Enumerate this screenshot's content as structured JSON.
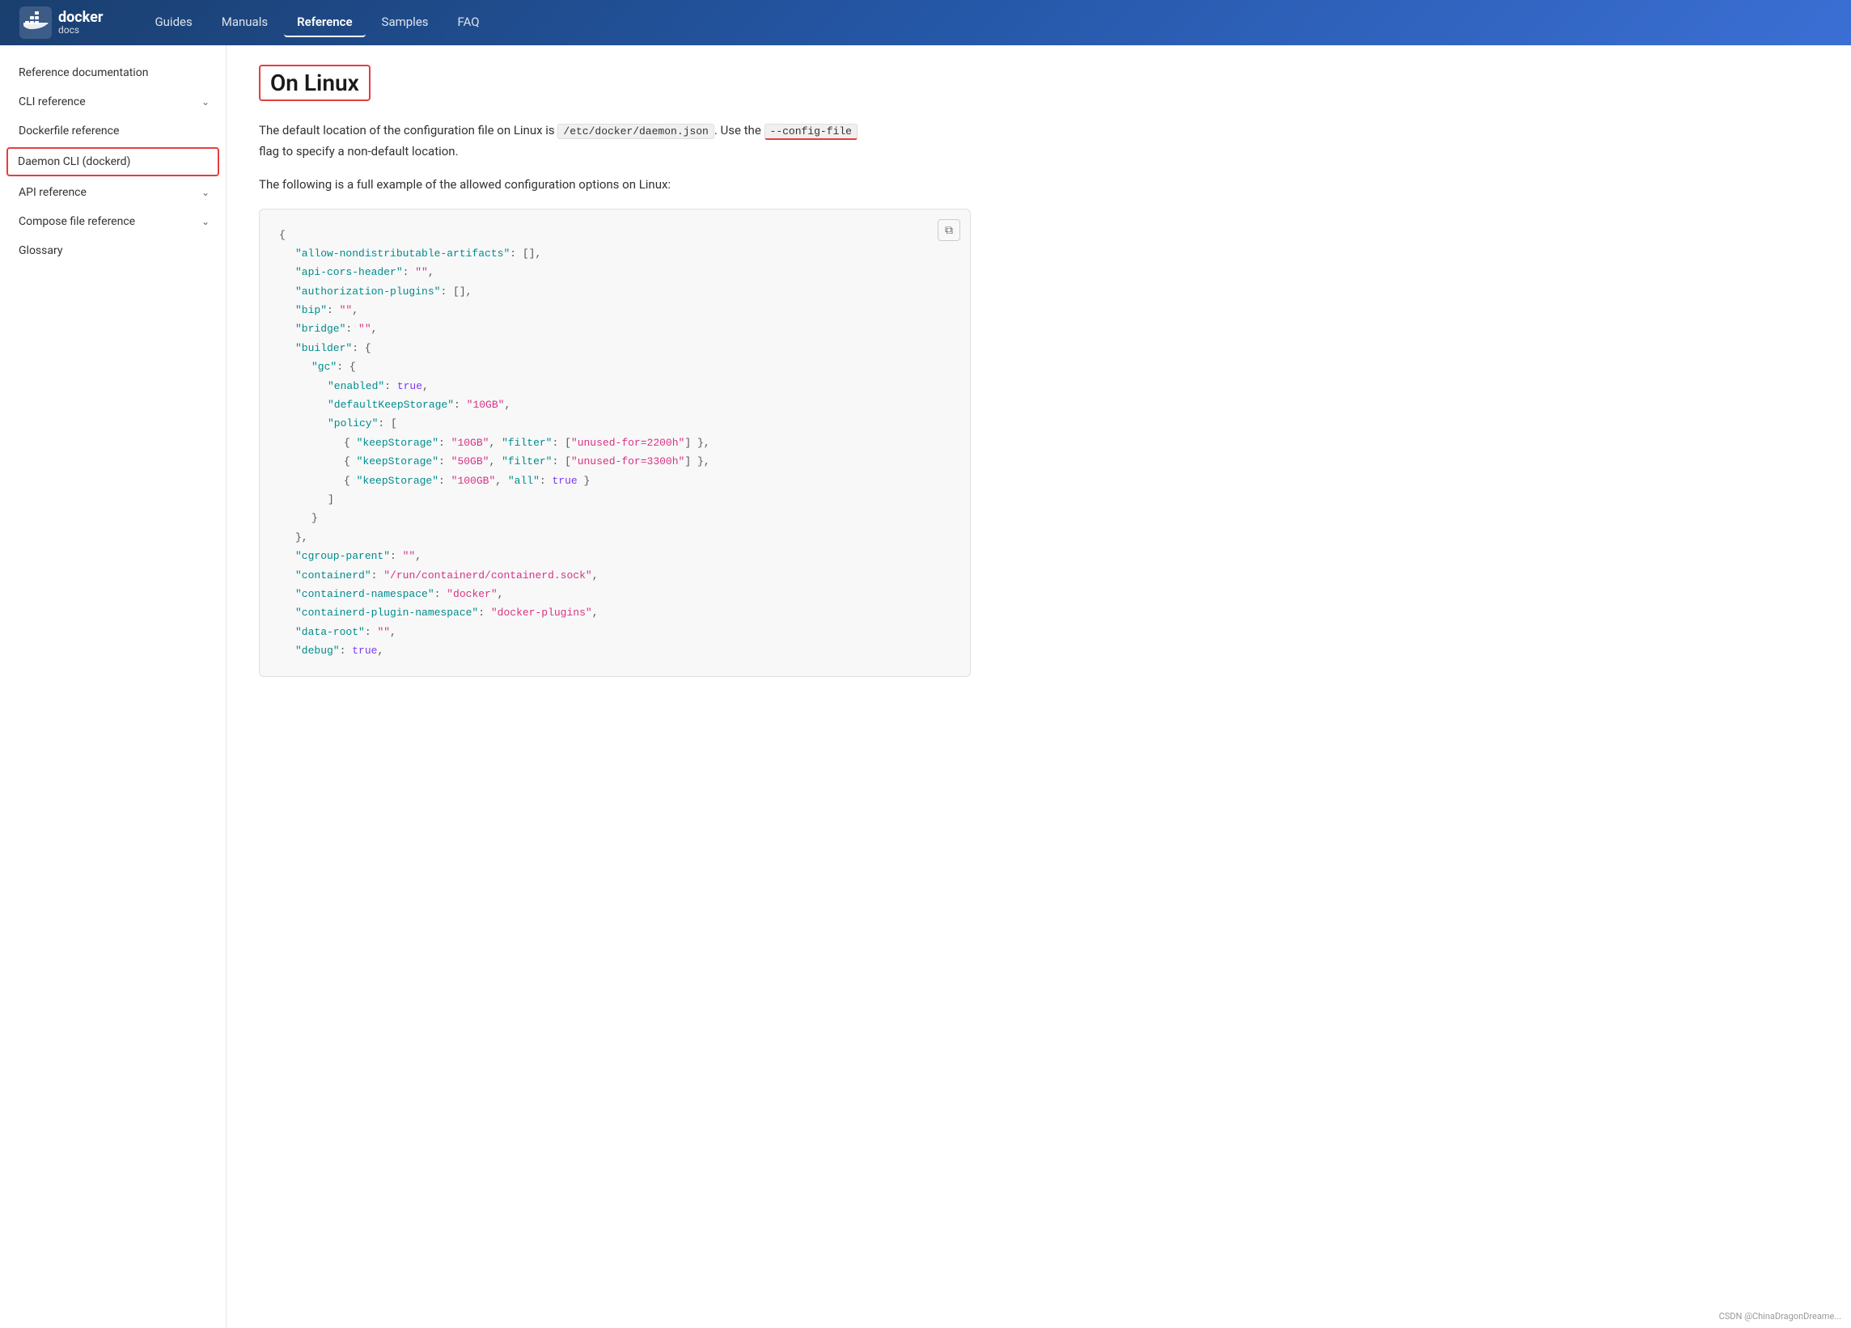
{
  "header": {
    "logo_line1": "docker",
    "logo_line2": "docs",
    "nav_items": [
      {
        "label": "Guides",
        "active": false
      },
      {
        "label": "Manuals",
        "active": false
      },
      {
        "label": "Reference",
        "active": true
      },
      {
        "label": "Samples",
        "active": false
      },
      {
        "label": "FAQ",
        "active": false
      }
    ]
  },
  "sidebar": {
    "items": [
      {
        "label": "Reference documentation",
        "has_chevron": false,
        "active": false
      },
      {
        "label": "CLI reference",
        "has_chevron": true,
        "active": false
      },
      {
        "label": "Dockerfile reference",
        "has_chevron": false,
        "active": false
      },
      {
        "label": "Daemon CLI (dockerd)",
        "has_chevron": false,
        "active": true
      },
      {
        "label": "API reference",
        "has_chevron": true,
        "active": false
      },
      {
        "label": "Compose file reference",
        "has_chevron": true,
        "active": false
      },
      {
        "label": "Glossary",
        "has_chevron": false,
        "active": false
      }
    ]
  },
  "main": {
    "title": "On Linux",
    "description1_pre": "The default location of the configuration file on Linux is ",
    "description1_code1": "/etc/docker/daemon.json",
    "description1_mid": ". Use the ",
    "description1_code2": "--config-file",
    "description1_post": "",
    "description1_line2": "flag to specify a non-default location.",
    "description2": "The following is a full example of the allowed configuration options on Linux:",
    "copy_button_label": "⧉",
    "code_lines": [
      {
        "indent": 0,
        "content": [
          {
            "type": "brace",
            "text": "{"
          }
        ]
      },
      {
        "indent": 1,
        "content": [
          {
            "type": "key",
            "text": "\"allow-nondistributable-artifacts\""
          },
          {
            "type": "punct",
            "text": ": "
          },
          {
            "type": "bracket",
            "text": "[]"
          },
          {
            "type": "punct",
            "text": ","
          }
        ]
      },
      {
        "indent": 1,
        "content": [
          {
            "type": "key",
            "text": "\"api-cors-header\""
          },
          {
            "type": "punct",
            "text": ": "
          },
          {
            "type": "string",
            "text": "\"\""
          },
          {
            "type": "punct",
            "text": ","
          }
        ]
      },
      {
        "indent": 1,
        "content": [
          {
            "type": "key",
            "text": "\"authorization-plugins\""
          },
          {
            "type": "punct",
            "text": ": "
          },
          {
            "type": "bracket",
            "text": "[]"
          },
          {
            "type": "punct",
            "text": ","
          }
        ]
      },
      {
        "indent": 1,
        "content": [
          {
            "type": "key",
            "text": "\"bip\""
          },
          {
            "type": "punct",
            "text": ": "
          },
          {
            "type": "string",
            "text": "\"\""
          },
          {
            "type": "punct",
            "text": ","
          }
        ]
      },
      {
        "indent": 1,
        "content": [
          {
            "type": "key",
            "text": "\"bridge\""
          },
          {
            "type": "punct",
            "text": ": "
          },
          {
            "type": "string",
            "text": "\"\""
          },
          {
            "type": "punct",
            "text": ","
          }
        ]
      },
      {
        "indent": 1,
        "content": [
          {
            "type": "key",
            "text": "\"builder\""
          },
          {
            "type": "punct",
            "text": ": "
          },
          {
            "type": "brace",
            "text": "{"
          }
        ]
      },
      {
        "indent": 2,
        "content": [
          {
            "type": "key",
            "text": "\"gc\""
          },
          {
            "type": "punct",
            "text": ": "
          },
          {
            "type": "brace",
            "text": "{"
          }
        ]
      },
      {
        "indent": 3,
        "content": [
          {
            "type": "key",
            "text": "\"enabled\""
          },
          {
            "type": "punct",
            "text": ": "
          },
          {
            "type": "bool",
            "text": "true"
          },
          {
            "type": "punct",
            "text": ","
          }
        ]
      },
      {
        "indent": 3,
        "content": [
          {
            "type": "key",
            "text": "\"defaultKeepStorage\""
          },
          {
            "type": "punct",
            "text": ": "
          },
          {
            "type": "string",
            "text": "\"10GB\""
          },
          {
            "type": "punct",
            "text": ","
          }
        ]
      },
      {
        "indent": 3,
        "content": [
          {
            "type": "key",
            "text": "\"policy\""
          },
          {
            "type": "punct",
            "text": ": "
          },
          {
            "type": "bracket",
            "text": "["
          }
        ]
      },
      {
        "indent": 4,
        "content": [
          {
            "type": "brace",
            "text": "{ "
          },
          {
            "type": "key",
            "text": "\"keepStorage\""
          },
          {
            "type": "punct",
            "text": ": "
          },
          {
            "type": "string",
            "text": "\"10GB\""
          },
          {
            "type": "punct",
            "text": ", "
          },
          {
            "type": "key",
            "text": "\"filter\""
          },
          {
            "type": "punct",
            "text": ": "
          },
          {
            "type": "bracket",
            "text": "["
          },
          {
            "type": "string",
            "text": "\"unused-for=2200h\""
          },
          {
            "type": "bracket",
            "text": "]"
          },
          {
            "type": "brace",
            "text": " }"
          },
          {
            "type": "punct",
            "text": ","
          }
        ]
      },
      {
        "indent": 4,
        "content": [
          {
            "type": "brace",
            "text": "{ "
          },
          {
            "type": "key",
            "text": "\"keepStorage\""
          },
          {
            "type": "punct",
            "text": ": "
          },
          {
            "type": "string",
            "text": "\"50GB\""
          },
          {
            "type": "punct",
            "text": ", "
          },
          {
            "type": "key",
            "text": "\"filter\""
          },
          {
            "type": "punct",
            "text": ": "
          },
          {
            "type": "bracket",
            "text": "["
          },
          {
            "type": "string",
            "text": "\"unused-for=3300h\""
          },
          {
            "type": "bracket",
            "text": "]"
          },
          {
            "type": "brace",
            "text": " }"
          },
          {
            "type": "punct",
            "text": ","
          }
        ]
      },
      {
        "indent": 4,
        "content": [
          {
            "type": "brace",
            "text": "{ "
          },
          {
            "type": "key",
            "text": "\"keepStorage\""
          },
          {
            "type": "punct",
            "text": ": "
          },
          {
            "type": "string",
            "text": "\"100GB\""
          },
          {
            "type": "punct",
            "text": ", "
          },
          {
            "type": "key",
            "text": "\"all\""
          },
          {
            "type": "punct",
            "text": ": "
          },
          {
            "type": "bool",
            "text": "true"
          },
          {
            "type": "brace",
            "text": " }"
          }
        ]
      },
      {
        "indent": 3,
        "content": [
          {
            "type": "bracket",
            "text": "]"
          }
        ]
      },
      {
        "indent": 2,
        "content": [
          {
            "type": "brace",
            "text": "}"
          }
        ]
      },
      {
        "indent": 1,
        "content": [
          {
            "type": "brace",
            "text": "},"
          }
        ]
      },
      {
        "indent": 1,
        "content": [
          {
            "type": "key",
            "text": "\"cgroup-parent\""
          },
          {
            "type": "punct",
            "text": ": "
          },
          {
            "type": "string",
            "text": "\"\""
          },
          {
            "type": "punct",
            "text": ","
          }
        ]
      },
      {
        "indent": 1,
        "content": [
          {
            "type": "key",
            "text": "\"containerd\""
          },
          {
            "type": "punct",
            "text": ": "
          },
          {
            "type": "string",
            "text": "\"/run/containerd/containerd.sock\""
          },
          {
            "type": "punct",
            "text": ","
          }
        ]
      },
      {
        "indent": 1,
        "content": [
          {
            "type": "key",
            "text": "\"containerd-namespace\""
          },
          {
            "type": "punct",
            "text": ": "
          },
          {
            "type": "string",
            "text": "\"docker\""
          },
          {
            "type": "punct",
            "text": ","
          }
        ]
      },
      {
        "indent": 1,
        "content": [
          {
            "type": "key",
            "text": "\"containerd-plugin-namespace\""
          },
          {
            "type": "punct",
            "text": ": "
          },
          {
            "type": "string",
            "text": "\"docker-plugins\""
          },
          {
            "type": "punct",
            "text": ","
          }
        ]
      },
      {
        "indent": 1,
        "content": [
          {
            "type": "key",
            "text": "\"data-root\""
          },
          {
            "type": "punct",
            "text": ": "
          },
          {
            "type": "string",
            "text": "\"\""
          },
          {
            "type": "punct",
            "text": ","
          }
        ]
      },
      {
        "indent": 1,
        "content": [
          {
            "type": "key",
            "text": "\"debug\""
          },
          {
            "type": "punct",
            "text": ": "
          },
          {
            "type": "bool",
            "text": "true"
          },
          {
            "type": "punct",
            "text": ","
          }
        ]
      }
    ]
  },
  "watermark": "CSDN @ChinaDragonDreame..."
}
